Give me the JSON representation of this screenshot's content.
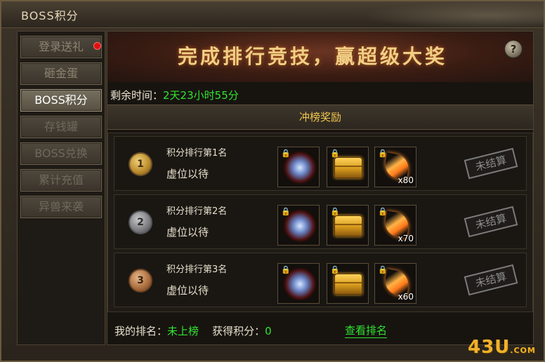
{
  "window": {
    "title": "BOSS积分",
    "close_icon": "close-icon"
  },
  "sidebar": {
    "items": [
      {
        "label": "登录送礼",
        "has_notification": true
      },
      {
        "label": "砸金蛋"
      },
      {
        "label": "BOSS积分",
        "active": true
      },
      {
        "label": "存钱罐"
      },
      {
        "label": "BOSS兑换"
      },
      {
        "label": "累计充值"
      },
      {
        "label": "异兽来袭"
      }
    ]
  },
  "banner": {
    "title": "完成排行竞技，赢超级大奖",
    "help_label": "?"
  },
  "timer": {
    "label": "剩余时间：",
    "value": "2天23小时55分"
  },
  "rewards_header": "冲榜奖励",
  "ranks": [
    {
      "medal": "1",
      "title": "积分排行第1名",
      "holder": "虚位以待",
      "status": "未结算",
      "items": [
        {
          "icon": "orb-icon"
        },
        {
          "icon": "treasure-chest-icon"
        },
        {
          "icon": "golden-feather-icon",
          "qty": "x80"
        }
      ]
    },
    {
      "medal": "2",
      "title": "积分排行第2名",
      "holder": "虚位以待",
      "status": "未结算",
      "items": [
        {
          "icon": "orb-icon"
        },
        {
          "icon": "treasure-chest-icon"
        },
        {
          "icon": "golden-feather-icon",
          "qty": "x70"
        }
      ]
    },
    {
      "medal": "3",
      "title": "积分排行第3名",
      "holder": "虚位以待",
      "status": "未结算",
      "items": [
        {
          "icon": "orb-icon"
        },
        {
          "icon": "treasure-chest-icon"
        },
        {
          "icon": "golden-feather-icon",
          "qty": "x60"
        }
      ]
    }
  ],
  "footer": {
    "my_rank_label": "我的排名：",
    "my_rank_value": "未上榜",
    "points_label": "获得积分：",
    "points_value": "0",
    "view_rank_link": "查看排名"
  },
  "watermark": {
    "main": "43U",
    "suffix": ".COM"
  },
  "colors": {
    "accent_green": "#31e331",
    "header_gold": "#f1c54d",
    "banner_gold": "#f1cf86"
  }
}
